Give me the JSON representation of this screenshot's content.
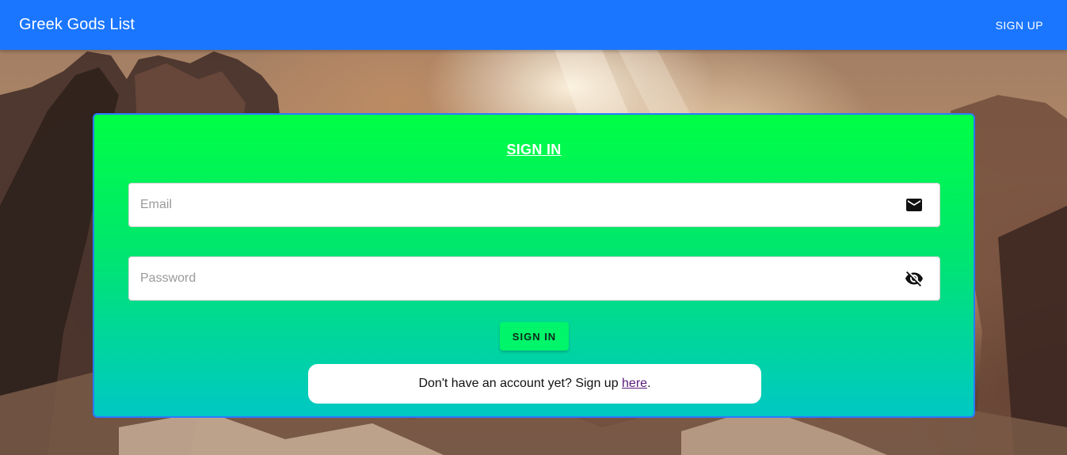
{
  "header": {
    "title": "Greek Gods List",
    "signup_label": "SIGN UP"
  },
  "form": {
    "title": "SIGN IN",
    "email": {
      "placeholder": "Email",
      "value": "",
      "icon": "mail-icon"
    },
    "password": {
      "placeholder": "Password",
      "value": "",
      "icon": "visibility-off-icon"
    },
    "submit_label": "SIGN IN",
    "signup_prompt": "Don't have an account yet? Sign up ",
    "signup_link": "here",
    "signup_suffix": "."
  },
  "colors": {
    "header": "#1a76ff",
    "card_top": "#00ff44",
    "card_bottom": "#00c8c4",
    "button": "#00f56a",
    "link": "#5b1a7a"
  }
}
